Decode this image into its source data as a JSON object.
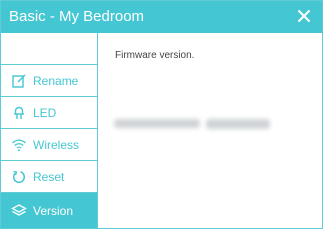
{
  "dialog": {
    "title": "Basic - My Bedroom",
    "close_icon": "close-icon"
  },
  "sidebar": {
    "items": [
      {
        "label": "Rename",
        "icon": "edit-icon",
        "active": false
      },
      {
        "label": "LED",
        "icon": "bulb-icon",
        "active": false
      },
      {
        "label": "Wireless",
        "icon": "wifi-icon",
        "active": false
      },
      {
        "label": "Reset",
        "icon": "reset-icon",
        "active": false
      },
      {
        "label": "Version",
        "icon": "layers-icon",
        "active": true
      }
    ]
  },
  "content": {
    "label": "Firmware version."
  },
  "colors": {
    "accent": "#45c6d3",
    "border": "#5fcbd6",
    "text": "#444444"
  }
}
